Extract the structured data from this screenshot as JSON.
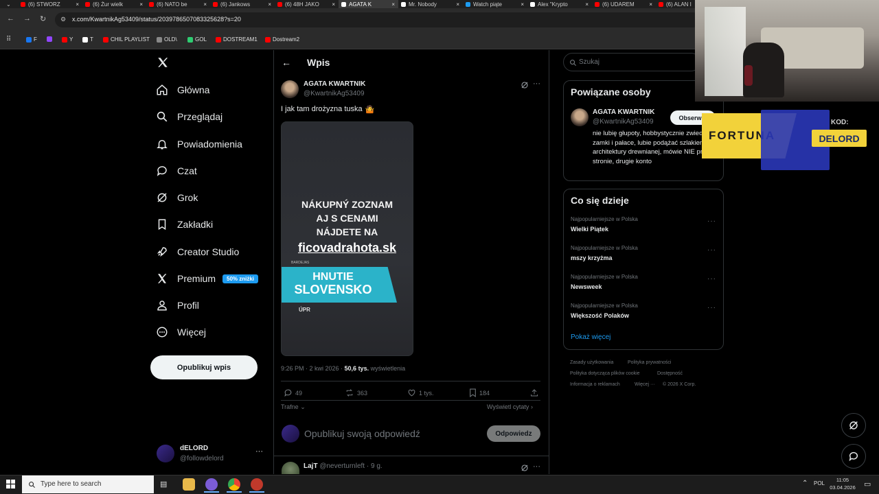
{
  "tabs": [
    {
      "label": "(6) STWORZ",
      "color": "#ff0000"
    },
    {
      "label": "(6) Żur wielk",
      "color": "#ff0000"
    },
    {
      "label": "(6) NATO be",
      "color": "#ff0000"
    },
    {
      "label": "(6) Jankows",
      "color": "#ff0000"
    },
    {
      "label": "(6) 48H JAKO",
      "color": "#ff0000"
    },
    {
      "label": "AGATA K",
      "color": "#ffffff"
    },
    {
      "label": "Mr. Nobody",
      "color": "#ffffff"
    },
    {
      "label": "Watch piąte",
      "color": "#1d9bf0"
    },
    {
      "label": "Alex \"Krypto",
      "color": "#ffffff"
    },
    {
      "label": "(6) UDAREM",
      "color": "#ff0000"
    },
    {
      "label": "(6) ALAN I",
      "color": "#ff0000"
    }
  ],
  "address": {
    "url": "x.com/KwartnikAg53409/status/2039786507083325628?s=20"
  },
  "bookmarks": [
    {
      "label": "F",
      "color": "#1877f2"
    },
    {
      "label": "",
      "color": "#9146ff"
    },
    {
      "label": "Y",
      "color": "#ff0000"
    },
    {
      "label": "T",
      "color": "#ffffff"
    },
    {
      "label": "CHIL PLAYLIST",
      "color": "#ff0000"
    },
    {
      "label": "OLD\\",
      "color": "#888888"
    },
    {
      "label": "GOL",
      "color": "#2ecc71"
    },
    {
      "label": "DOSTREAM1",
      "color": "#ff0000"
    },
    {
      "label": "Dostream2",
      "color": "#ff0000"
    }
  ],
  "nav": {
    "items": [
      {
        "label": "Główna",
        "icon": "home-icon"
      },
      {
        "label": "Przeglądaj",
        "icon": "search-icon"
      },
      {
        "label": "Powiadomienia",
        "icon": "bell-icon"
      },
      {
        "label": "Czat",
        "icon": "chat-icon"
      },
      {
        "label": "Grok",
        "icon": "grok-icon"
      },
      {
        "label": "Zakładki",
        "icon": "bookmark-icon"
      },
      {
        "label": "Creator Studio",
        "icon": "rocket-icon"
      },
      {
        "label": "Premium",
        "icon": "x-icon",
        "badge": "50% zniżki"
      },
      {
        "label": "Profil",
        "icon": "profile-icon"
      },
      {
        "label": "Więcej",
        "icon": "more-icon"
      }
    ],
    "post_button": "Opublikuj wpis",
    "account": {
      "name": "dELORD",
      "handle": "@followdelord"
    }
  },
  "post": {
    "header_title": "Wpis",
    "author_name": "AGATA KWARTNIK",
    "author_handle": "@KwartnikAg53409",
    "text": "I jak tam drożyzna tuska",
    "emoji": "🤷",
    "image": {
      "line1": "NÁKUPNÝ ZOZNAM",
      "line2": "AJ S CENAMI",
      "line3": "NÁJDETE NA",
      "site": "ficovadrahota.sk",
      "small_label": "BARDEJAS",
      "banner1": "HNUTIE",
      "banner2": "SLOVENSKO",
      "bottom": "ÚPR"
    },
    "meta_time": "9:26 PM · 2 kwi 2026 · ",
    "meta_views": "50,6 tys.",
    "meta_views_label": " wyświetlenia",
    "replies": "49",
    "reposts": "363",
    "likes": "1 tys.",
    "bookmarks": "184",
    "sort_label": "Trafne",
    "quotes_label": "Wyświetl cytaty",
    "reply_placeholder": "Opublikuj swoją odpowiedź",
    "reply_button": "Odpowiedz"
  },
  "next_reply": {
    "name": "LajT",
    "handle": "@neverturnleft",
    "time": "· 9 g."
  },
  "right": {
    "search_placeholder": "Szukaj",
    "related_title": "Powiązane osoby",
    "related_name": "AGATA KWARTNIK",
    "related_handle": "@KwartnikAg53409",
    "follow_button": "Obserwuj",
    "related_bio": "nie lubię głupoty, hobbystycznie zwiedzam zamki i pałace, lubie podążać szlakiem architektury drewnianej, mówie NIE prawej stronie, drugie konto",
    "trends_title": "Co się dzieje",
    "trends": [
      {
        "sub": "Najpopularniejsze w Polska",
        "title": "Wielki Piątek"
      },
      {
        "sub": "Najpopularniejsze w Polska",
        "title": "mszy krzyżma"
      },
      {
        "sub": "Najpopularniejsze w Polska",
        "title": "Newsweek"
      },
      {
        "sub": "Najpopularniejsze w Polska",
        "title": "Większość Polaków"
      }
    ],
    "show_more": "Pokaż więcej",
    "footer": [
      "Zasady użytkowania",
      "Polityka prywatności",
      "Polityka dotycząca plików cookie",
      "Dostępność",
      "Informacja o reklamach",
      "Więcej ···",
      "© 2026 X Corp."
    ]
  },
  "overlay": {
    "brand": "FORTUNA",
    "code_label": "KOD:",
    "code": "DELORD"
  },
  "taskbar": {
    "search_placeholder": "Type here to search",
    "lang": "POL",
    "time": "11:05",
    "date": "03.04.2026"
  }
}
